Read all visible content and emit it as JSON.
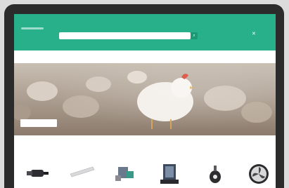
{
  "header": {
    "logo_text": "",
    "search_placeholder": "",
    "search_category": "",
    "link_text": "",
    "account_text": ""
  },
  "nav": {
    "items": [
      "",
      "",
      "",
      ""
    ]
  },
  "hero": {
    "title": "",
    "button": ""
  },
  "products": {
    "section_title": "",
    "view_all": ""
  },
  "colors": {
    "brand": "#27b08a",
    "nav_accent": "#e56b8a"
  },
  "icons": {
    "search_button": "search-icon",
    "close": "close-icon",
    "products": [
      "plug-icon",
      "lamp-icon",
      "valve-icon",
      "floodlight-icon",
      "feeder-icon",
      "fan-icon"
    ]
  }
}
